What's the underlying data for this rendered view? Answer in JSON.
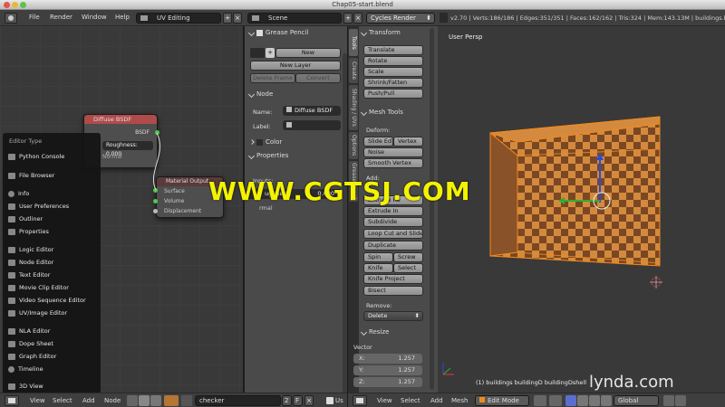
{
  "window": {
    "title": "Chap05-start.blend"
  },
  "topbar": {
    "menus": [
      "File",
      "Render",
      "Window",
      "Help"
    ],
    "layout": "UV Editing",
    "scene": "Scene",
    "engine": "Cycles Render",
    "stats": "v2.70 | Verts:186/186 | Edges:351/351 | Faces:162/162 | Tris:324 | Mem:143.13M | buildings.b"
  },
  "node_editor": {
    "diffuse_node": {
      "title": "Diffuse BSDF",
      "output": "BSDF",
      "roughness": "Roughness: 0.000",
      "normal": "Normal"
    },
    "output_node": {
      "title": "Material Output",
      "inputs": [
        "Surface",
        "Volume",
        "Displacement"
      ]
    }
  },
  "editor_type_menu": {
    "heading": "Editor Type",
    "groups": [
      [
        "Python Console"
      ],
      [
        "File Browser"
      ],
      [
        "Info",
        "User Preferences",
        "Outliner",
        "Properties"
      ],
      [
        "Logic Editor",
        "Node Editor",
        "Text Editor",
        "Movie Clip Editor",
        "Video Sequence Editor",
        "UV/Image Editor"
      ],
      [
        "NLA Editor",
        "Dope Sheet",
        "Graph Editor",
        "Timeline"
      ],
      [
        "3D View"
      ]
    ]
  },
  "properties": {
    "grease_pencil": "Grease Pencil",
    "new": "New",
    "new_layer": "New Layer",
    "delete_frame": "Delete Frame",
    "convert": "Convert",
    "node_header": "Node",
    "name_label": "Name:",
    "name_value": "Diffuse BSDF",
    "label_label": "Label:",
    "color": "Color",
    "properties_header": "Properties",
    "inputs": "Inputs:",
    "roughness_fragment": "ughness:",
    "roughness_value": "0.000",
    "normal_fragment": "rmal"
  },
  "tool_tabs": [
    "Tools",
    "Create",
    "Shading / UVs",
    "Options",
    "Grease Pencil"
  ],
  "tools": {
    "transform_header": "Transform",
    "transform": [
      "Translate",
      "Rotate",
      "Scale",
      "Shrink/Fatten",
      "Push/Pull"
    ],
    "mesh_tools_header": "Mesh Tools",
    "deform_label": "Deform:",
    "slide_edge": "Slide Ed",
    "vertex": "Vertex",
    "noise": "Noise",
    "smooth_vertex": "Smooth Vertex",
    "add_label": "Add:",
    "extrude_region": "Extrude Re",
    "extrude_indiv": "Extrude In",
    "subdivide": "Subdivide",
    "loop_cut": "Loop Cut and Slide",
    "duplicate": "Duplicate",
    "spin": "Spin",
    "screw": "Screw",
    "knife": "Knife",
    "select": "Select",
    "knife_project": "Knife Project",
    "bisect": "Bisect",
    "remove_label": "Remove:",
    "delete": "Delete",
    "resize_header": "Resize",
    "vector_label": "Vector",
    "vx": "X:",
    "vy": "Y:",
    "vz": "Z:",
    "vx_val": "1.257",
    "vy_val": "1.257",
    "vz_val": "1.257"
  },
  "viewport": {
    "label": "User Persp",
    "object_info": "(1) buildings buildingD buildingDshell"
  },
  "bottom_left": {
    "items": [
      "View",
      "Select",
      "Add",
      "Node"
    ],
    "material": "checker",
    "users": "2",
    "f": "F",
    "use_nodes": "Us"
  },
  "bottom_right": {
    "items": [
      "View",
      "Select",
      "Add",
      "Mesh"
    ],
    "mode": "Edit Mode",
    "orientation": "Global"
  },
  "watermarks": {
    "main": "WWW.CGTSJ.COM",
    "brand": "lynda.com"
  },
  "colors": {
    "accent_orange": "#f08a1c",
    "checker_light": "#d48a3e",
    "checker_dark": "#7a4722",
    "watermark": "#f3f300"
  }
}
